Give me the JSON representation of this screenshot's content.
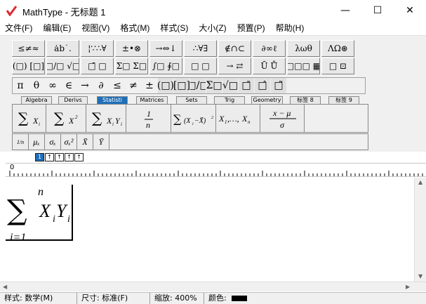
{
  "app": {
    "title": "MathType - 无标题 1"
  },
  "window_controls": {
    "minimize": "—",
    "maximize": "☐",
    "close": "✕"
  },
  "menu": [
    "文件(F)",
    "编辑(E)",
    "视图(V)",
    "格式(M)",
    "样式(S)",
    "大小(Z)",
    "预置(P)",
    "帮助(H)"
  ],
  "palette_row1": [
    "≤≠≈",
    "ȧb˙.",
    "¦∵∴∀",
    "±•⊗",
    "→⇔↓",
    "∴∀∃",
    "∉∩⊂",
    "∂∞ℓ",
    "λωθ",
    "ΛΩ⊛"
  ],
  "palette_row2": [
    "(□) [□]",
    "□/□ √□",
    "□̄ □",
    "Σ□ Σ□",
    "∫□ ∮□",
    "□ □",
    "→ ⇄",
    "Ū Ů",
    "□□□ ▦",
    "□ ⊡"
  ],
  "palette_row3": [
    "π",
    "θ",
    "∞",
    "∈",
    "→",
    "∂",
    "≤",
    "≠",
    "±",
    "(□)",
    "[□]",
    "□/□",
    "Σ□",
    "√□",
    "□̄",
    "□̂",
    "□̃"
  ],
  "tabs": [
    "Algebra",
    "Derivs",
    "Statisti",
    "Matrices",
    "Sets",
    "Trig",
    "Geometry",
    "标签 8",
    "标签 9"
  ],
  "active_tab": "Statisti",
  "templates": [
    "ΣXᵢ",
    "ΣXᵢ²",
    "ΣXᵢYᵢ",
    "1/n",
    "Σ(Xᵢ−X̄)²",
    "X₁,…,Xₙ",
    "(x−μ)/σ"
  ],
  "sub_templates": [
    "1/n",
    "μₓ",
    "σₓ",
    "σₓ²",
    "X̄",
    "Ȳ"
  ],
  "ctrl_buttons": [
    "1",
    "↑",
    "↑",
    "↑",
    "↑"
  ],
  "ruler_zero": "0",
  "equation": {
    "upper": "n",
    "lower": "i=1",
    "sum_symbol": "∑",
    "var1": "X",
    "sub1": "i",
    "var2": "Y",
    "sub2": "i"
  },
  "status": {
    "style_label": "样式:",
    "style_value": "数学(M)",
    "size_label": "尺寸:",
    "size_value": "标准(F)",
    "zoom_label": "缩放:",
    "zoom_value": "400%",
    "color_label": "颜色:"
  },
  "colors": {
    "accent": "#1e6fb8",
    "app_icon": "#e0282e"
  }
}
